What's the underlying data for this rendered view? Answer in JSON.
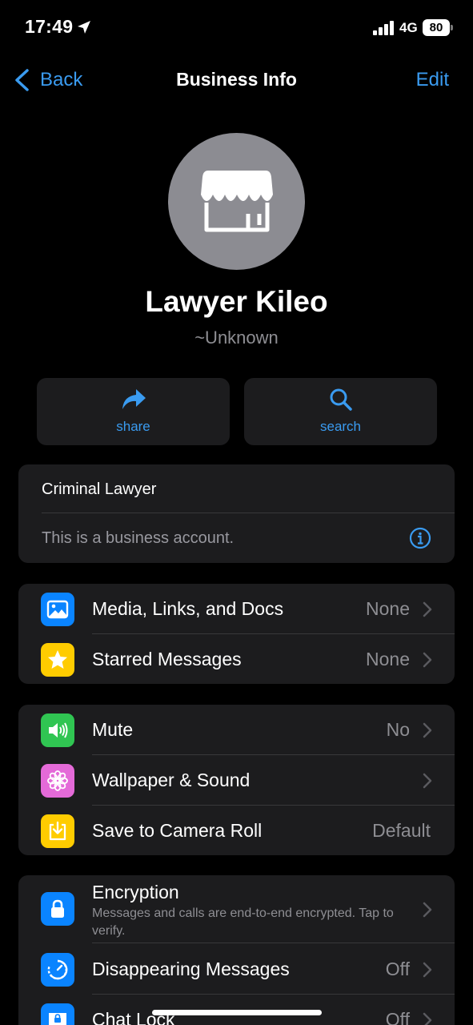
{
  "status_bar": {
    "time": "17:49",
    "network": "4G",
    "battery": "80"
  },
  "nav": {
    "back_label": "Back",
    "title": "Business Info",
    "edit_label": "Edit"
  },
  "profile": {
    "name": "Lawyer Kileo",
    "subtitle": "~Unknown"
  },
  "actions": [
    {
      "label": "share",
      "icon": "share-arrow-icon"
    },
    {
      "label": "search",
      "icon": "search-icon"
    }
  ],
  "about": {
    "category": "Criminal Lawyer",
    "description": "This is a business account."
  },
  "media_section": [
    {
      "label": "Media, Links, and Docs",
      "value": "None",
      "icon": "photo-icon",
      "icon_color": "#0a84ff"
    },
    {
      "label": "Starred Messages",
      "value": "None",
      "icon": "star-icon",
      "icon_color": "#ffcc00"
    }
  ],
  "settings_section": [
    {
      "label": "Mute",
      "value": "No",
      "icon": "speaker-icon",
      "icon_color": "#30c552"
    },
    {
      "label": "Wallpaper & Sound",
      "value": "",
      "icon": "flower-icon",
      "icon_color": "#e46ad8"
    },
    {
      "label": "Save to Camera Roll",
      "value": "Default",
      "icon": "download-icon",
      "icon_color": "#ffcc00"
    }
  ],
  "privacy_section": [
    {
      "label": "Encryption",
      "description": "Messages and calls are end-to-end encrypted. Tap to verify.",
      "icon": "lock-icon",
      "icon_color": "#0a84ff"
    },
    {
      "label": "Disappearing Messages",
      "value": "Off",
      "icon": "timer-icon",
      "icon_color": "#0a84ff"
    },
    {
      "label": "Chat Lock",
      "value": "Off",
      "icon": "chat-lock-icon",
      "icon_color": "#0a84ff"
    }
  ],
  "colors": {
    "accent": "#3a9bf0",
    "background": "#000000",
    "card": "#1c1c1e"
  }
}
